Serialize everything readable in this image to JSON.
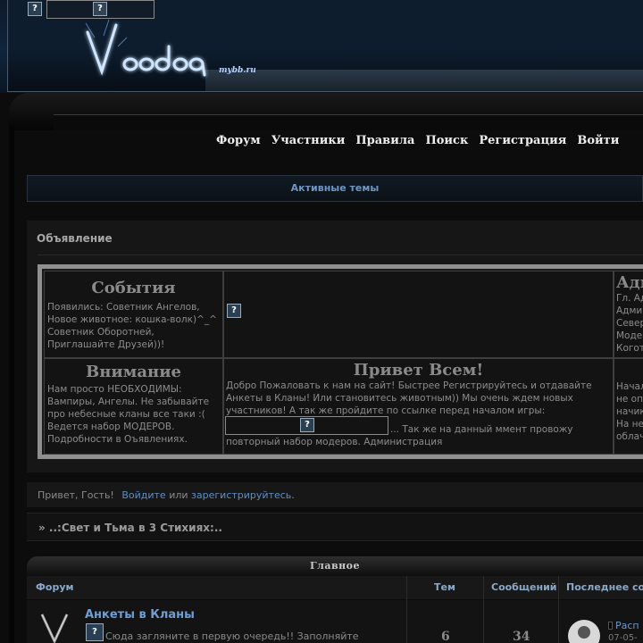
{
  "header": {
    "logo_text": "Voodoo",
    "logo_sub": "mybb.ru"
  },
  "nav": {
    "items": [
      "Форум",
      "Участники",
      "Правила",
      "Поиск",
      "Регистрация",
      "Войти"
    ]
  },
  "active_topics": "Активные темы",
  "announcement": {
    "title": "Объявление",
    "events": {
      "heading": "События",
      "text": "Появились: Советник Ангелов, Новое животное: кошка-волк)^_^ Советник Оборотней, Приглашайте Друзей))!"
    },
    "admin": {
      "heading": "Адм",
      "lines": [
        "Гл. Ад",
        "Адми",
        "Север",
        "Моде",
        "Когот"
      ]
    },
    "attention": {
      "heading": "Внимание",
      "text": "Нам просто НЕОБХОДИМЫ: Вампиры, Ангелы. Не забывайте про небесные кланы все таки :( Ведется набор МОДЕРОВ. Подробности в Оъявлениях."
    },
    "welcome": {
      "heading": "Привет Всем!",
      "text": "Добро Пожаловать к нам на сайт! Быстрее Регистрируйтесь и отдавайте Анкеты в Кланы! Или становитесь животным)) Мы очень ждем новых участников! А так же пройдите по ссылке перед началом игры:",
      "text_after": "... Так же на данный ммент провожу повторный набор модеров. Администрация"
    },
    "right_col": {
      "lines": [
        "Начал",
        "не оп",
        "начик",
        "На не",
        "облач"
      ]
    }
  },
  "greeting": {
    "prefix": "Привет, Гость!",
    "login": "Войдите",
    "or": "или",
    "register": "зарегистрируйтесь",
    "suffix": "."
  },
  "breadcrumb": "» ..:Свет и Тьма в 3 Стихиях:..",
  "category": {
    "title": "Главное",
    "columns": {
      "forum": "Форум",
      "topics": "Тем",
      "posts": "Сообщений",
      "last_post": "Последнее соо"
    },
    "forums": [
      {
        "title": "Анкеты в Кланы",
        "description": "Сюда загляните в первую очередь!! Заполняйте",
        "topics": "6",
        "posts": "34",
        "last_post_title": "Расп",
        "last_post_date": "07-05-"
      }
    ]
  }
}
